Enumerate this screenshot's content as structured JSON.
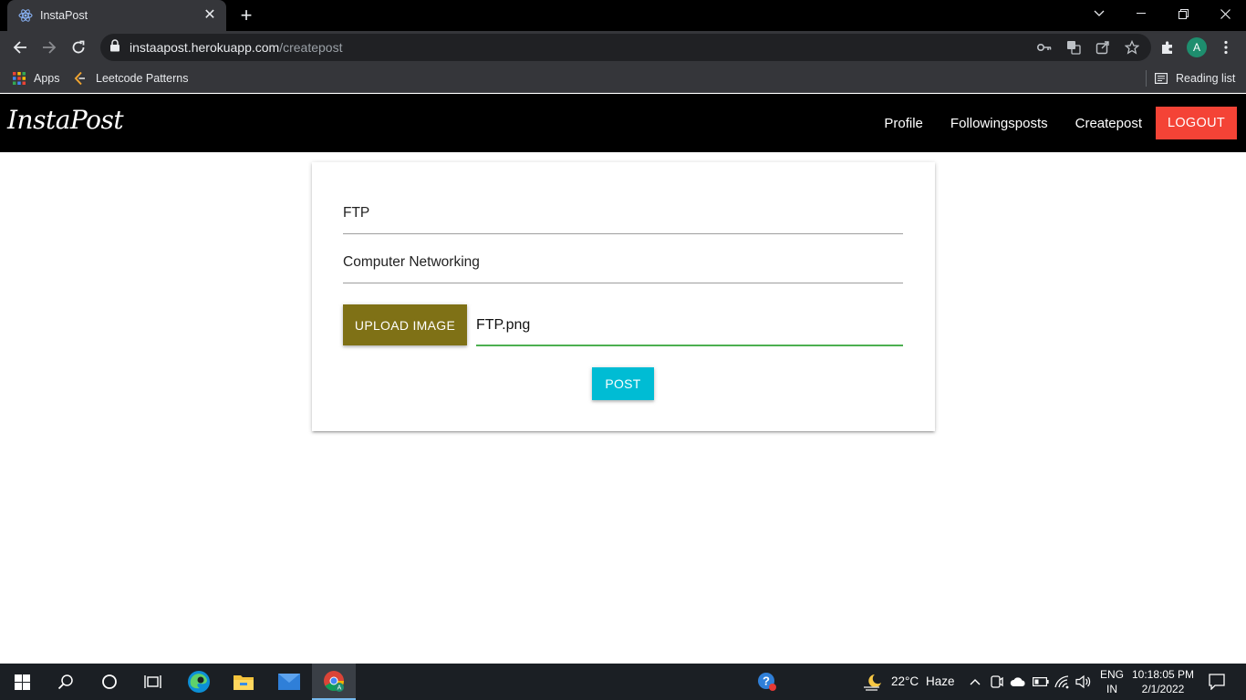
{
  "browser": {
    "tab": {
      "title": "InstaPost"
    },
    "url": {
      "host": "instaapost.herokuapp.com",
      "path": "/createpost"
    },
    "profile_initial": "A",
    "bookmarks": [
      {
        "label": "Apps",
        "icon": "apps-grid-icon"
      },
      {
        "label": "Leetcode Patterns",
        "icon": "leetcode-icon"
      }
    ],
    "reading_list": "Reading list"
  },
  "app": {
    "brand": "InstaPost",
    "nav": [
      "Profile",
      "Followingsposts",
      "Createpost"
    ],
    "logout_label": "LOGOUT",
    "accent_colors": {
      "logout": "#f44336",
      "upload": "#7f7116",
      "post": "#00bcd4",
      "file_underline": "#4caf50"
    }
  },
  "form": {
    "title_value": "FTP",
    "body_value": "Computer Networking",
    "upload_label": "UPLOAD IMAGE",
    "file_name": "FTP.png",
    "post_label": "POST"
  },
  "taskbar": {
    "weather": {
      "temp": "22°C",
      "condition": "Haze"
    },
    "language": {
      "line1": "ENG",
      "line2": "IN"
    },
    "clock": {
      "time": "10:18:05 PM",
      "date": "2/1/2022"
    }
  }
}
